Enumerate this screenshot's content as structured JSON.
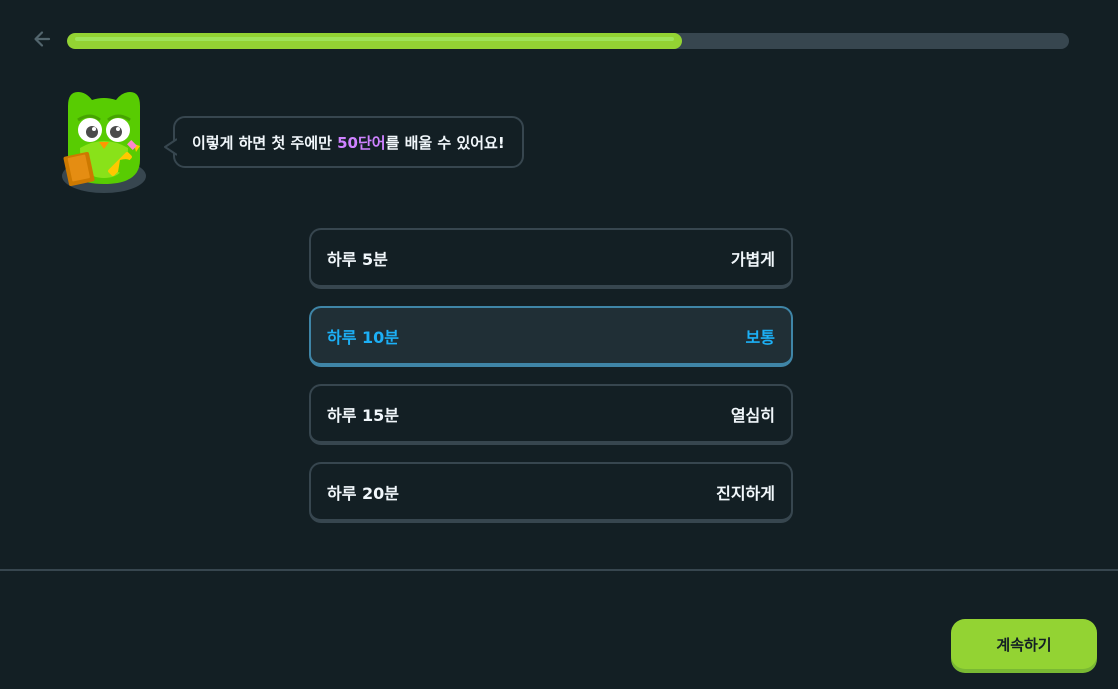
{
  "header": {
    "back_icon": "arrow-left-icon",
    "progress_fraction": 0.614
  },
  "coach": {
    "mascot": "owl-mascot",
    "message_before": "이렇게 하면 첫 주에만 ",
    "message_highlight": "50단어",
    "message_after": "를 배울 수 있어요!",
    "highlight_color": "#ce82ff"
  },
  "options": [
    {
      "time": "하루 5분",
      "level": "가볍게",
      "selected": false
    },
    {
      "time": "하루 10분",
      "level": "보통",
      "selected": true
    },
    {
      "time": "하루 15분",
      "level": "열심히",
      "selected": false
    },
    {
      "time": "하루 20분",
      "level": "진지하게",
      "selected": false
    }
  ],
  "footer": {
    "continue_label": "계속하기"
  },
  "colors": {
    "background": "#131f24",
    "accent_green": "#93d333",
    "selected_blue": "#1cb0f6",
    "border": "#37464f"
  }
}
